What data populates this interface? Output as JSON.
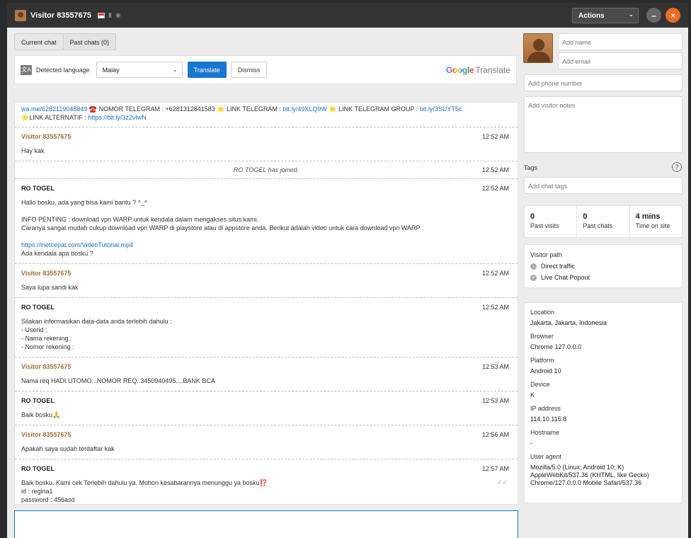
{
  "window": {
    "title": "Visitor 83557675",
    "actions_label": "Actions",
    "minimize_glyph": "–",
    "close_glyph": "×"
  },
  "tabs": [
    {
      "label": "Current chat"
    },
    {
      "label": "Past chats (0)"
    }
  ],
  "translate": {
    "detected_label": "Detected language",
    "language": "Malay",
    "translate_button": "Translate",
    "dismiss_button": "Dismiss",
    "brand_google": "Google",
    "brand_translate": "Translate"
  },
  "messages": {
    "top": {
      "link1": "wa.me/6282119048849",
      "text1": " ☎️ NOMOR TELEGRAM : +6281312841583 ⭐ LINK TELEGRAM : ",
      "link2": "bit.ly/49XLQ9W",
      "text2": " ⭐ LINK TELEGRAM GROUP : ",
      "link3": "bit.ly/3SUYT5c",
      "text3": "⭐LINK ALTERNATIF : ",
      "link4": "https://bit.ly/3z2vIwN"
    },
    "m1": {
      "sender": "Visitor 83557675",
      "time": "12:52 AM",
      "body": "Hay kak"
    },
    "sys": {
      "text": "RO TOGEL has joined.",
      "time": "12:52 AM"
    },
    "m2": {
      "sender": "RO TOGEL",
      "time": "12:52 AM",
      "body_a": "Hallo bosku, ada yang bisa kami bantu ? ^_^\n\nINFO PENTING : download vpn WARP untuk kendala dalam mengakses situs kami.\nCaranya sangat mudah cukup download vpn WARP di playstore atau di appstore anda. Berikut adalah video untuk cara download vpn WARP .\n\n",
      "link": "https://inetcepat.com/VideoTutorial.mp4",
      "body_b": "Ada kendala apa bosku ?"
    },
    "m3": {
      "sender": "Visitor 83557675",
      "time": "12:52 AM",
      "body": "Saya lupa sandi kak"
    },
    "m4": {
      "sender": "RO TOGEL",
      "time": "12:52 AM",
      "body": "Silakan informasikan data-data anda terlebih dahulu :\n- Userid :\n- Nama rekening :\n- Nomor rekening :"
    },
    "m5": {
      "sender": "Visitor 83557675",
      "time": "12:53 AM",
      "body": "Nama req HADI UTOMO...NOMOR REQ..3450940495....BANK BCA"
    },
    "m6": {
      "sender": "RO TOGEL",
      "time": "12:53 AM",
      "body": "Baik bosku🙏"
    },
    "m7": {
      "sender": "Visitor 83557675",
      "time": "12:56 AM",
      "body": "Apakah saya sudah terdaftar kak"
    },
    "m8": {
      "sender": "RO TOGEL",
      "time": "12:57 AM",
      "body": "Baik bosku. Kami cek Terlebih dahulu ya. Mohon kesabarannya menunggu ya bosku⁉️\nid : regina1\npassword : 456asd\nsilahkan dicoba login dan ubah kembali kata sandi demi menjaga keamanan akun anda.",
      "read_glyph": "✓✓"
    }
  },
  "visitor": {
    "name_placeholder": "Add name",
    "email_placeholder": "Add email",
    "phone_placeholder": "Add phone number",
    "notes_placeholder": "Add visitor notes",
    "tags_label": "Tags",
    "tags_placeholder": "Add chat tags",
    "help_glyph": "?"
  },
  "stats": [
    {
      "value": "0",
      "label": "Past visits"
    },
    {
      "value": "0",
      "label": "Past chats"
    },
    {
      "value": "4 mins",
      "label": "Time on site"
    }
  ],
  "visitor_path": {
    "title": "Visitor path",
    "items": [
      "Direct traffic",
      "Live Chat Popout"
    ]
  },
  "info": {
    "location_label": "Location",
    "location": "Jakarta, Jakarta, Indonesia",
    "browser_label": "Browser",
    "browser": "Chrome 127.0.0.0",
    "platform_label": "Platform",
    "platform": "Android 10",
    "device_label": "Device",
    "device": "K",
    "ip_label": "IP address",
    "ip": "114.10.115.8",
    "hostname_label": "Hostname",
    "hostname": "-",
    "ua_label": "User agent",
    "ua": "Mozilla/5.0 (Linux; Android 10; K) AppleWebKit/537.36 (KHTML, like Gecko) Chrome/127.0.0.0 Mobile Safari/537.36"
  },
  "colors": {
    "accent": "#1976d2",
    "close": "#f26a21",
    "visitor_name": "#a0703a",
    "link": "#1a6fc3"
  }
}
